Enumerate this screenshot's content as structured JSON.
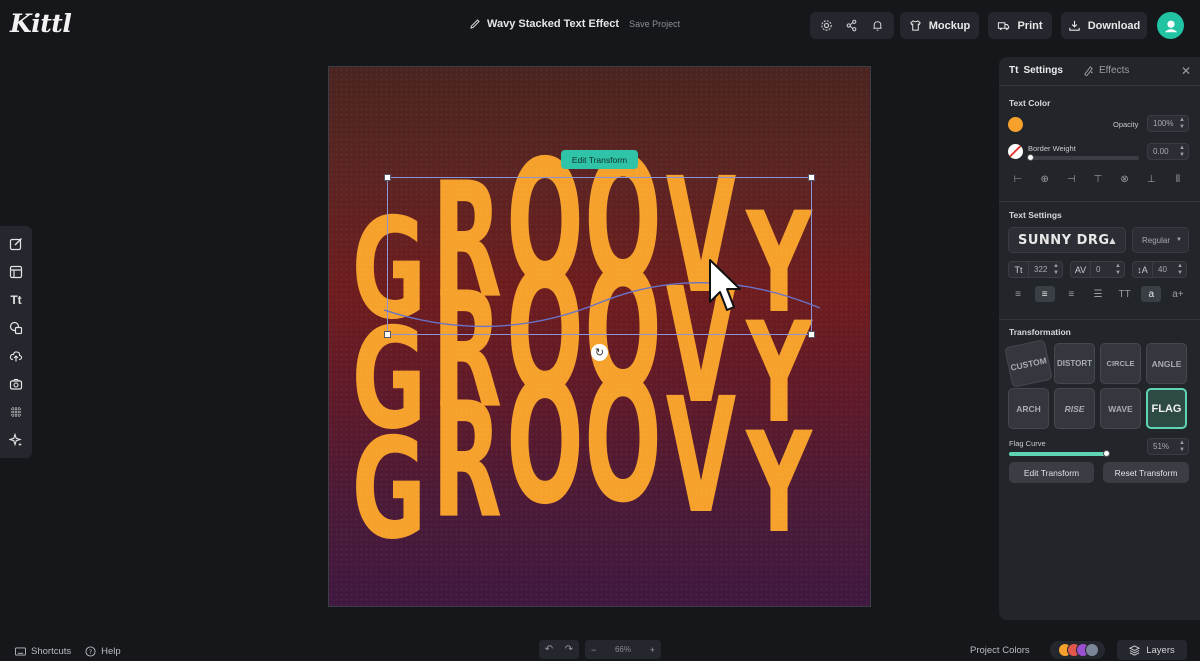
{
  "app": {
    "logo": "Kittl"
  },
  "header": {
    "project_title": "Wavy Stacked Text Effect",
    "save_label": "Save Project",
    "icons": [
      "settings-icon",
      "share-icon",
      "bell-icon"
    ],
    "mockup_label": "Mockup",
    "print_label": "Print",
    "download_label": "Download",
    "avatar_initial": ""
  },
  "left_toolbar": {
    "items": [
      "edit-icon",
      "templates-icon",
      "text-icon",
      "shapes-icon",
      "upload-icon",
      "photos-icon",
      "grid-icon",
      "ai-sparkle-icon"
    ],
    "text_glyph": "Tt"
  },
  "canvas": {
    "text": "GROOVY",
    "text_color": "#f5a12b",
    "edit_transform_label": "Edit Transform"
  },
  "panel": {
    "tab_settings": "Settings",
    "tab_effects": "Effects",
    "text_color_heading": "Text Color",
    "opacity_label": "Opacity",
    "opacity_value": "100%",
    "border_weight_label": "Border Weight",
    "border_weight_value": "0.00",
    "text_settings_heading": "Text Settings",
    "font_name": "SUNNY DRG",
    "font_weight": "Regular",
    "font_size": "322",
    "letter_spacing": "0",
    "line_height": "40",
    "transformation_heading": "Transformation",
    "transforms": [
      "CUSTOM",
      "DISTORT",
      "CIRCLE",
      "ANGLE",
      "ARCH",
      "RISE",
      "WAVE",
      "FLAG"
    ],
    "active_transform": "FLAG",
    "flag_curve_label": "Flag Curve",
    "flag_curve_value": "51%",
    "flag_curve_fraction": 0.51,
    "edit_transform_btn": "Edit Transform",
    "reset_transform_btn": "Reset Transform"
  },
  "bottom": {
    "shortcuts_label": "Shortcuts",
    "help_label": "Help",
    "zoom_value": "66%",
    "project_colors_label": "Project Colors",
    "swatch_colors": [
      "#f5a12b",
      "#e2574c",
      "#9b4fd1",
      "#7b8798"
    ],
    "layers_label": "Layers"
  }
}
